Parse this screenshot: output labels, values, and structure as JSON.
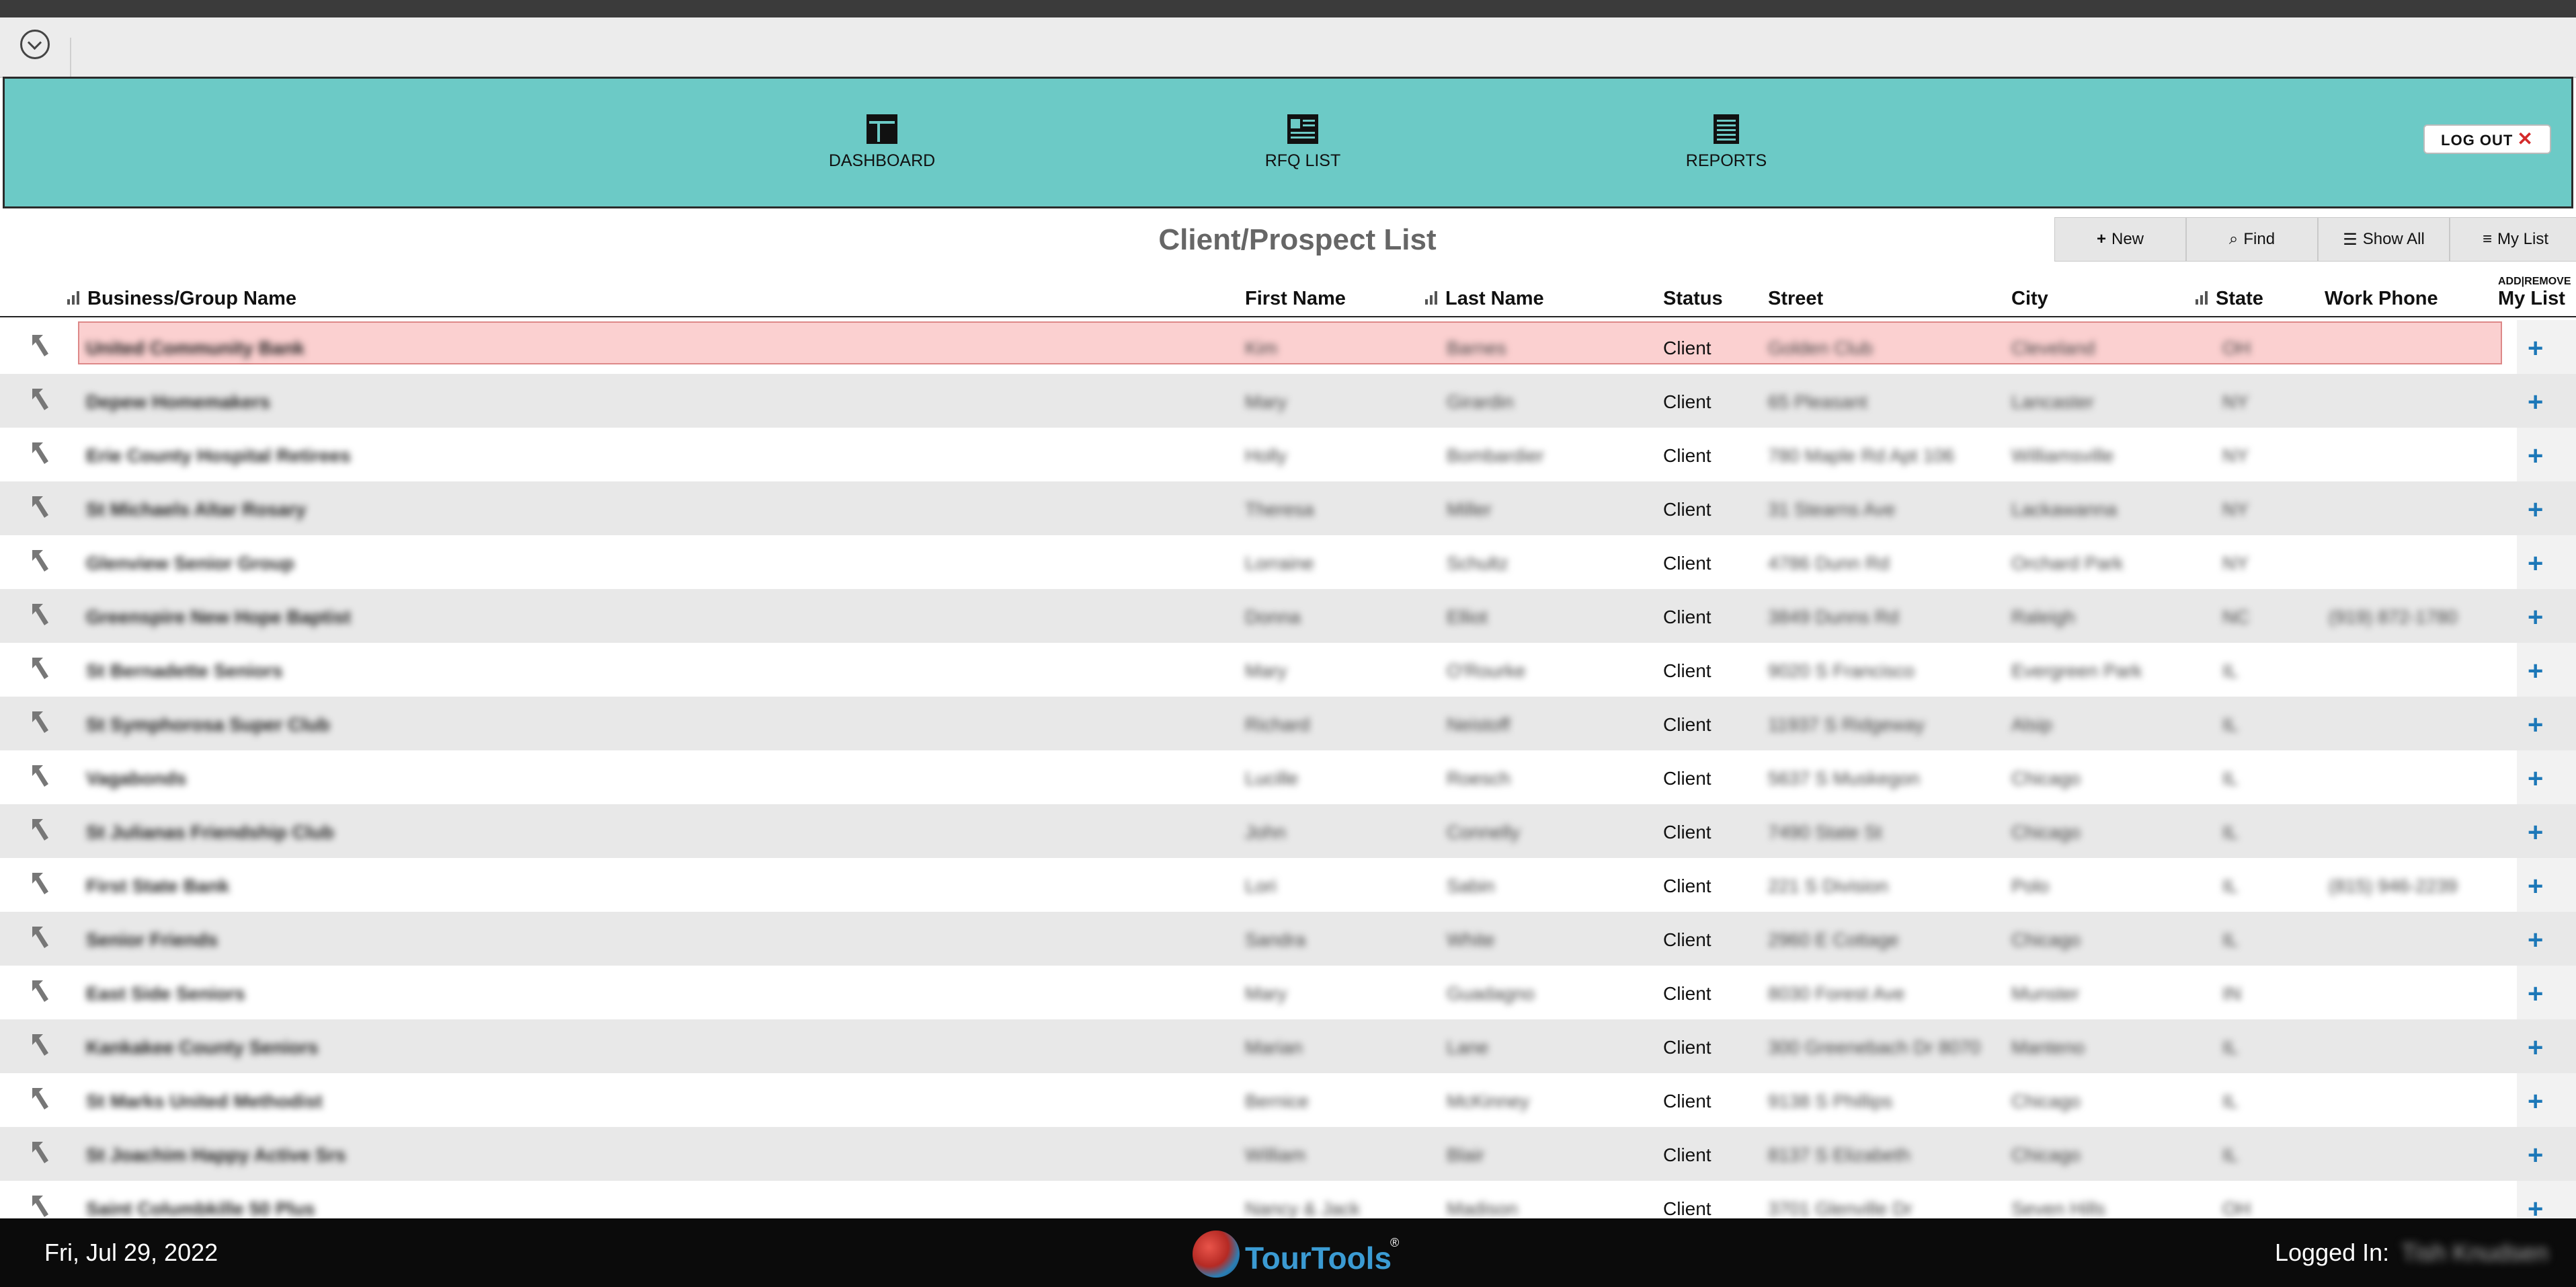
{
  "toolbar": {
    "toggle_icon": "chevron-down-circle-icon"
  },
  "nav": [
    {
      "label": "DASHBOARD",
      "icon": "dashboard-icon"
    },
    {
      "label": "RFQ LIST",
      "icon": "rfq-list-icon"
    },
    {
      "label": "REPORTS",
      "icon": "reports-icon"
    }
  ],
  "logout": {
    "label": "LOG OUT",
    "x": "✕"
  },
  "page": {
    "title": "Client/Prospect List"
  },
  "actions": [
    {
      "label": "New",
      "icon": "+"
    },
    {
      "label": "Find",
      "icon": "⌕"
    },
    {
      "label": "Show All",
      "icon": "☰"
    },
    {
      "label": "My List",
      "icon": "≡"
    }
  ],
  "table": {
    "headers": {
      "business": "Business/Group Name",
      "first": "First Name",
      "last": "Last Name",
      "status": "Status",
      "street": "Street",
      "city": "City",
      "state": "State",
      "phone": "Work Phone",
      "mylist_top": "ADD|REMOVE",
      "mylist": "My List"
    },
    "rows": [
      {
        "business": "United Community Bank",
        "first": "Kim",
        "last": "Barnes",
        "status": "Client",
        "street": "Golden Club",
        "city": "Cleveland",
        "state": "OH",
        "phone": ""
      },
      {
        "business": "Depew Homemakers",
        "first": "Mary",
        "last": "Girardin",
        "status": "Client",
        "street": "65 Pleasant",
        "city": "Lancaster",
        "state": "NY",
        "phone": ""
      },
      {
        "business": "Erie County Hospital Retirees",
        "first": "Holly",
        "last": "Bombardier",
        "status": "Client",
        "street": "780 Maple Rd Apt 106",
        "city": "Williamsville",
        "state": "NY",
        "phone": ""
      },
      {
        "business": "St Michaels Altar Rosary",
        "first": "Theresa",
        "last": "Miller",
        "status": "Client",
        "street": "31 Stearns Ave",
        "city": "Lackawanna",
        "state": "NY",
        "phone": ""
      },
      {
        "business": "Glenview Senior Group",
        "first": "Lorraine",
        "last": "Schultz",
        "status": "Client",
        "street": "4786 Dunn Rd",
        "city": "Orchard Park",
        "state": "NY",
        "phone": ""
      },
      {
        "business": "Greenspire New Hope Baptist",
        "first": "Donna",
        "last": "Elliot",
        "status": "Client",
        "street": "3849 Dunns Rd",
        "city": "Raleigh",
        "state": "NC",
        "phone": "(919) 872-1780"
      },
      {
        "business": "St Bernadette Seniors",
        "first": "Mary",
        "last": "O'Rourke",
        "status": "Client",
        "street": "9020 S Francisco",
        "city": "Evergreen Park",
        "state": "IL",
        "phone": ""
      },
      {
        "business": "St Symphorosa Super Club",
        "first": "Richard",
        "last": "Neistoff",
        "status": "Client",
        "street": "11937 S Ridgeway",
        "city": "Alsip",
        "state": "IL",
        "phone": ""
      },
      {
        "business": "Vagabonds",
        "first": "Lucille",
        "last": "Roesch",
        "status": "Client",
        "street": "5637 S Muskegon",
        "city": "Chicago",
        "state": "IL",
        "phone": ""
      },
      {
        "business": "St Julianas Friendship Club",
        "first": "John",
        "last": "Connelly",
        "status": "Client",
        "street": "7490 State St",
        "city": "Chicago",
        "state": "IL",
        "phone": ""
      },
      {
        "business": "First State Bank",
        "first": "Lori",
        "last": "Sabin",
        "status": "Client",
        "street": "221 S Division",
        "city": "Polo",
        "state": "IL",
        "phone": "(815) 946-2239"
      },
      {
        "business": "Senior Friends",
        "first": "Sandra",
        "last": "White",
        "status": "Client",
        "street": "2960 E Cottage",
        "city": "Chicago",
        "state": "IL",
        "phone": ""
      },
      {
        "business": "East Side Seniors",
        "first": "Mary",
        "last": "Guadagno",
        "status": "Client",
        "street": "8030 Forest Ave",
        "city": "Munster",
        "state": "IN",
        "phone": ""
      },
      {
        "business": "Kankakee County Seniors",
        "first": "Marian",
        "last": "Lane",
        "status": "Client",
        "street": "300 Greenebach Dr 8070",
        "city": "Manteno",
        "state": "IL",
        "phone": ""
      },
      {
        "business": "St Marks United Methodist",
        "first": "Bernice",
        "last": "McKinney",
        "status": "Client",
        "street": "9138 S Phillips",
        "city": "Chicago",
        "state": "IL",
        "phone": ""
      },
      {
        "business": "St Joachim Happy Active Srs",
        "first": "William",
        "last": "Blair",
        "status": "Client",
        "street": "8137 S Elizabeth",
        "city": "Chicago",
        "state": "IL",
        "phone": ""
      },
      {
        "business": "Saint Columbkille 50 Plus",
        "first": "Nancy & Jack",
        "last": "Madison",
        "status": "Client",
        "street": "3701 Glenville Dr",
        "city": "Seven Hills",
        "state": "OH",
        "phone": ""
      }
    ]
  },
  "footer": {
    "date": "Fri, Jul 29, 2022",
    "brand": "TourTools",
    "reg": "®",
    "logged_label": "Logged In:",
    "user": "Tish Knudsen"
  }
}
